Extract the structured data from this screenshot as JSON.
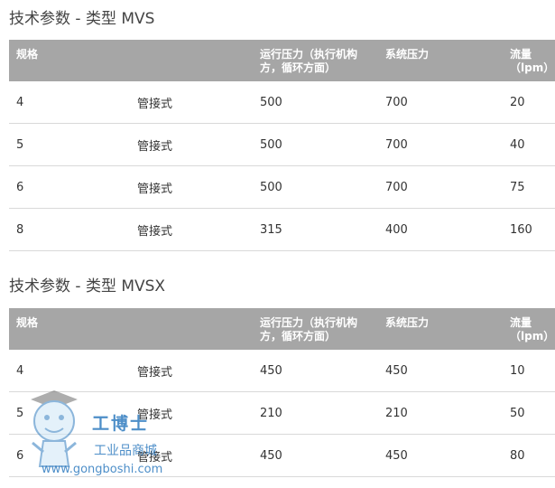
{
  "sections": [
    {
      "title": "技术参数 - 类型 MVS",
      "headers": [
        "规格",
        "",
        "运行压力（执行机构方，循环方面）",
        "系统压力",
        "流量（lpm）"
      ],
      "rows": [
        [
          "4",
          "管接式",
          "500",
          "700",
          "20"
        ],
        [
          "5",
          "管接式",
          "500",
          "700",
          "40"
        ],
        [
          "6",
          "管接式",
          "500",
          "700",
          "75"
        ],
        [
          "8",
          "管接式",
          "315",
          "400",
          "160"
        ]
      ]
    },
    {
      "title": "技术参数 - 类型 MVSX",
      "headers": [
        "规格",
        "",
        "运行压力（执行机构方，循环方面）",
        "系统压力",
        "流量（lpm）"
      ],
      "rows": [
        [
          "4",
          "管接式",
          "450",
          "450",
          "10"
        ],
        [
          "5",
          "管接式",
          "210",
          "210",
          "50"
        ],
        [
          "6",
          "管接式",
          "450",
          "450",
          "80"
        ]
      ]
    }
  ],
  "watermark": {
    "brand": "工博士",
    "tagline": "工业品商城",
    "url": "www.gongboshi.com",
    "color": "#2f7bbf",
    "icon": "mascot-icon"
  }
}
